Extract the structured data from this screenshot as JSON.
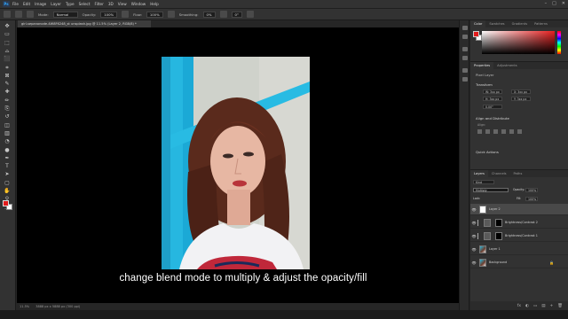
{
  "app": {
    "logo": "Ps"
  },
  "menu": [
    "File",
    "Edit",
    "Image",
    "Layer",
    "Type",
    "Select",
    "Filter",
    "3D",
    "View",
    "Window",
    "Help"
  ],
  "window_controls": [
    "–",
    "□",
    "✕"
  ],
  "options_bar": {
    "mode_label": "Mode:",
    "mode_value": "Normal",
    "opacity_label": "Opacity:",
    "opacity_value": "100%",
    "flow_label": "Flow:",
    "flow_value": "100%",
    "smoothing_label": "Smoothing:",
    "smoothing_value": "0%",
    "angle_value": "0°"
  },
  "document": {
    "tab_title": "girl-sepanonode-4W8F6248_st unsplash.jpg @ 11.5% (Layer 2, RGB/8) *"
  },
  "status_bar": {
    "zoom": "11.5%",
    "info": "3888 px x 5888 px (300 ppi)"
  },
  "caption": "change blend mode to multiply & adjust the opacity/fill",
  "color_panel": {
    "tabs": [
      "Color",
      "Swatches",
      "Gradients",
      "Patterns"
    ],
    "fg_color": "#e21b1b",
    "bg_color": "#ffffff"
  },
  "properties_panel": {
    "tabs": [
      "Properties",
      "Adjustments"
    ],
    "layer_kind": "Pixel Layer",
    "transform_title": "Transform",
    "w": "W: 3xx px",
    "h": "H: 3xx px",
    "x": "X: 3xx px",
    "y": "Y: 3xx px",
    "angle": "0.00°",
    "align_title": "Align and Distribute",
    "align_sub": "Align:",
    "quick_actions": "Quick Actions"
  },
  "layers_panel": {
    "tabs": [
      "Layers",
      "Channels",
      "Paths"
    ],
    "kind_label": "Kind",
    "blend_mode": "Multiply",
    "opacity_label": "Opacity:",
    "opacity_value": "100%",
    "lock_label": "Lock:",
    "fill_label": "Fill:",
    "fill_value": "100%",
    "layers": [
      {
        "name": "Layer 2",
        "thumb": "wht",
        "selected": true,
        "mask": false,
        "lock": ""
      },
      {
        "name": "Brightness/Contrast 2",
        "thumb": "adj",
        "selected": false,
        "mask": true,
        "lock": ""
      },
      {
        "name": "Brightness/Contrast 1",
        "thumb": "adj",
        "selected": false,
        "mask": true,
        "lock": ""
      },
      {
        "name": "Layer 1",
        "thumb": "img",
        "selected": false,
        "mask": false,
        "lock": ""
      },
      {
        "name": "Background",
        "thumb": "img",
        "selected": false,
        "mask": false,
        "lock": "🔒"
      }
    ],
    "footer_icons": [
      "fx",
      "◐",
      "▭",
      "▤",
      "+",
      "🗑"
    ]
  },
  "toolbar_icons": [
    "move-icon",
    "artboard-icon",
    "marquee-icon",
    "lasso-icon",
    "object-select-icon",
    "crop-icon",
    "frame-icon",
    "eyedropper-icon",
    "healing-icon",
    "brush-icon",
    "clone-stamp-icon",
    "history-brush-icon",
    "eraser-icon",
    "gradient-icon",
    "blur-icon",
    "dodge-icon",
    "pen-icon",
    "type-icon",
    "path-select-icon",
    "rectangle-icon",
    "hand-icon",
    "zoom-icon",
    "more-tools-icon"
  ],
  "toolbar_glyphs": [
    "✥",
    "▭",
    "⬚",
    "⌓",
    "⬛",
    "⌗",
    "⊠",
    "✎",
    "✚",
    "✏",
    "⎘",
    "↺",
    "◫",
    "▥",
    "◔",
    "●",
    "✒",
    "T",
    "➤",
    "▢",
    "✋",
    "⚲",
    "…"
  ]
}
